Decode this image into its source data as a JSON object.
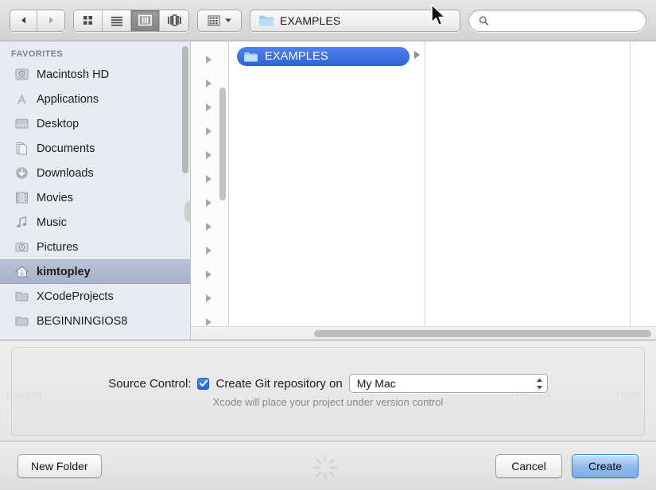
{
  "toolbar": {
    "nav": [
      {
        "name": "back-button",
        "icon": "triangle-left-icon",
        "enabled": true
      },
      {
        "name": "forward-button",
        "icon": "triangle-right-icon",
        "enabled": false
      }
    ],
    "view_modes": [
      {
        "name": "icon-view-button",
        "icon": "grid-icon",
        "active": false
      },
      {
        "name": "list-view-button",
        "icon": "list-icon",
        "active": false
      },
      {
        "name": "column-view-button",
        "icon": "columns-icon",
        "active": true
      },
      {
        "name": "coverflow-view-button",
        "icon": "coverflow-icon",
        "active": false
      }
    ],
    "arrange": {
      "label": "",
      "icon": "arrange-grid-icon",
      "chevron": "chevron-down-icon"
    },
    "path_popup": {
      "label": "EXAMPLES",
      "icon": "folder-icon"
    },
    "search": {
      "value": "",
      "placeholder": "",
      "icon": "search-icon"
    }
  },
  "sidebar": {
    "header": "FAVORITES",
    "items": [
      {
        "label": "Macintosh HD",
        "icon": "harddisk-icon",
        "selected": false
      },
      {
        "label": "Applications",
        "icon": "applications-icon",
        "selected": false
      },
      {
        "label": "Desktop",
        "icon": "desktop-icon",
        "selected": false
      },
      {
        "label": "Documents",
        "icon": "documents-icon",
        "selected": false
      },
      {
        "label": "Downloads",
        "icon": "downloads-icon",
        "selected": false
      },
      {
        "label": "Movies",
        "icon": "movies-icon",
        "selected": false
      },
      {
        "label": "Music",
        "icon": "music-icon",
        "selected": false
      },
      {
        "label": "Pictures",
        "icon": "pictures-icon",
        "selected": false
      },
      {
        "label": "kimtopley",
        "icon": "home-icon",
        "selected": true
      },
      {
        "label": "XCodeProjects",
        "icon": "folder-icon",
        "selected": false
      },
      {
        "label": "BEGINNINGIOS8",
        "icon": "folder-icon",
        "selected": false
      }
    ]
  },
  "browser": {
    "selected_folder": {
      "label": "EXAMPLES",
      "icon": "folder-icon"
    },
    "disclosure_icon": "triangle-right-icon",
    "resize_grip": "||"
  },
  "accessory": {
    "source_control_label": "Source Control:",
    "checkbox": {
      "label": "Create Git repository on",
      "checked": true,
      "icon": "checkmark-icon"
    },
    "popup": {
      "value": "My Mac",
      "icon": "stepper-icon"
    },
    "hint": "Xcode will place your project under version control",
    "ghost_cancel": "Cancel",
    "ghost_previous": "Previous",
    "ghost_next": "Next"
  },
  "bottom": {
    "new_folder_label": "New Folder",
    "cancel_label": "Cancel",
    "create_label": "Create",
    "spinner_icon": "progress-spinner-icon"
  },
  "colors": {
    "selection_blue": "#2f62d8",
    "sidebar_selection": "#a7b3ca",
    "default_button_blue": "#8fb8ee",
    "checkbox_blue": "#1f66d8"
  }
}
